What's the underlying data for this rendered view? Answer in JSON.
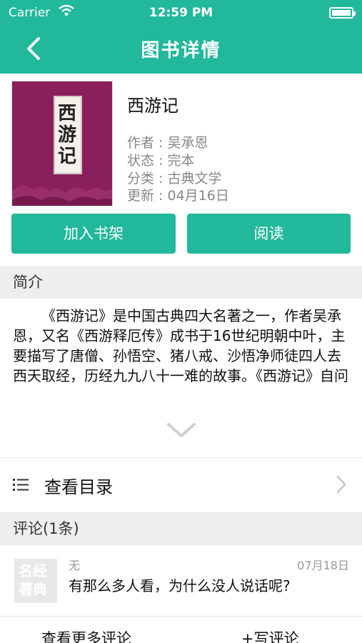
{
  "status": {
    "carrier": "Carrier",
    "time": "12:59 PM",
    "battery_level": 1.0
  },
  "nav": {
    "title": "图书详情"
  },
  "book": {
    "cover_text": "西游记",
    "title": "西游记",
    "author": "作者 : 吴承恩",
    "state": "状态 : 完本",
    "category": "分类 : 古典文学",
    "updated": "更新 : 04月16日"
  },
  "actions": {
    "add_to_shelf": "加入书架",
    "read": "阅读"
  },
  "intro": {
    "header": "简介",
    "text": "《西游记》是中国古典四大名著之一，作者吴承恩，又名《西游释厄传》成书于16世纪明朝中叶，主要描写了唐僧、孙悟空、猪八戒、沙悟净师徒四人去西天取经，历经九九八十一难的故事。《西游记》自问"
  },
  "catalog": {
    "label": "查看目录"
  },
  "comments": {
    "header": "评论(1条)",
    "avatar_text": "名经著典",
    "items": [
      {
        "user": "无",
        "date": "07月18日",
        "text": "有那么多人看，为什么没人说话呢?"
      }
    ],
    "more_label": "查看更多评论",
    "write_label": "+写评论"
  },
  "colors": {
    "accent": "#22b89b",
    "cover": "#8a1f5d",
    "section_bg": "#eeeeee"
  }
}
